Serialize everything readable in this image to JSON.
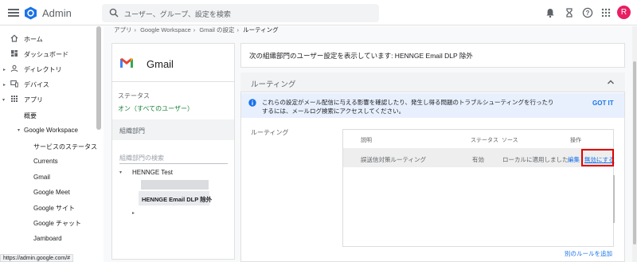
{
  "header": {
    "app_name": "Admin",
    "search_placeholder": "ユーザー、グループ、設定を検索",
    "avatar_initial": "R",
    "icons": [
      "menu-icon",
      "admin-logo-icon",
      "search-icon",
      "bell-icon",
      "hourglass-icon",
      "help-icon",
      "apps-grid-icon"
    ]
  },
  "sidebar": {
    "items": [
      {
        "label": "ホーム",
        "icon": "home-icon"
      },
      {
        "label": "ダッシュボード",
        "icon": "dashboard-icon"
      },
      {
        "label": "ディレクトリ",
        "icon": "person-icon"
      },
      {
        "label": "デバイス",
        "icon": "devices-icon"
      },
      {
        "label": "アプリ",
        "icon": "apps-icon"
      }
    ],
    "sub": {
      "overview": "概要",
      "workspace": "Google Workspace",
      "service_status": "サービスのステータス",
      "currents": "Currents",
      "gmail": "Gmail",
      "meet": "Google Meet",
      "sites": "Google サイト",
      "chat": "Google チャット",
      "jamboard": "Jamboard"
    }
  },
  "status_url": "https://admin.google.com/#",
  "breadcrumb": [
    "アプリ",
    "Google Workspace",
    "Gmail の設定",
    "ルーティング"
  ],
  "left_card": {
    "title": "Gmail",
    "status_label": "ステータス",
    "status_value": "オン（すべてのユーザー）",
    "org_label": "組織部門",
    "org_search_placeholder": "組織部門の検索",
    "tree_root": "HENNGE Test",
    "tree_selected": "HENNGE Email DLP 除外"
  },
  "top_card": {
    "text": "次の組織部門のユーザー設定を表示しています: HENNGE Email DLP 除外"
  },
  "panel": {
    "title": "ルーティング",
    "info_text": "これらの設定がメール配信に与える影響を確認したり、発生し得る問題のトラブルシューティングを行ったりするには、メールログ検索にアクセスしてください。",
    "got_it": "GOT IT",
    "section_label": "ルーティング",
    "columns": [
      "説明",
      "ステータス",
      "ソース",
      "操作"
    ],
    "rows": [
      {
        "description": "誤送信対策ルーティング",
        "status": "有効",
        "source": "ローカルに適用しました",
        "edit": "編集",
        "disable": "無効にする"
      }
    ],
    "add_rule": "別のルールを追加"
  },
  "colors": {
    "accent": "#1a73e8",
    "highlight_box": "#e00000",
    "avatar": "#e91e63",
    "info_bg": "#e8f0fe"
  }
}
